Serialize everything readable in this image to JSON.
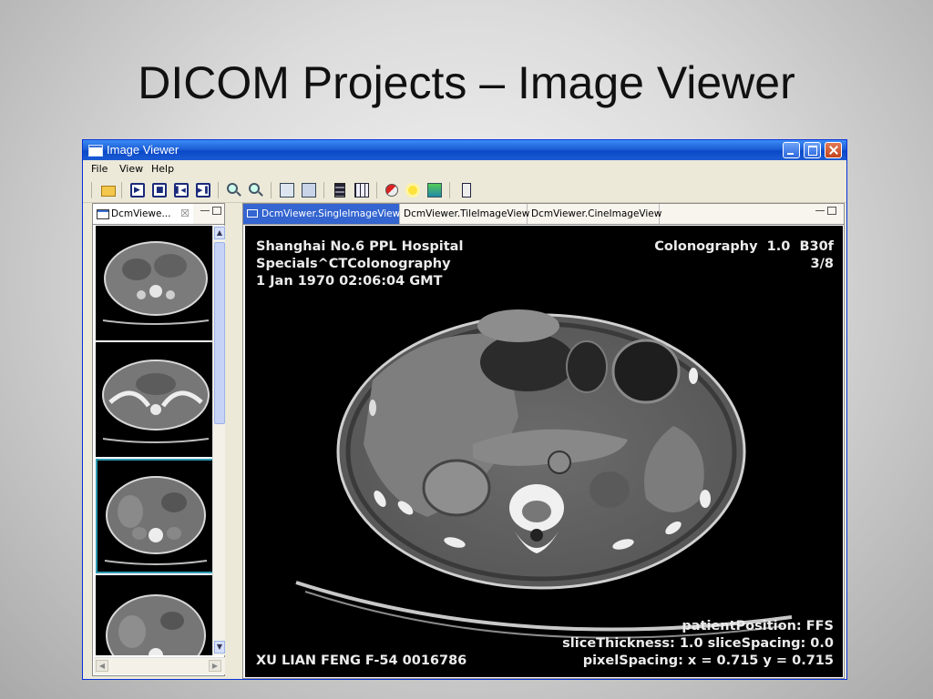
{
  "slide": {
    "title": "DICOM Projects – Image Viewer"
  },
  "window": {
    "title": "Image Viewer",
    "controls": [
      "minimize",
      "maximize",
      "close"
    ]
  },
  "menu": {
    "items": [
      "File",
      "View",
      "Help"
    ]
  },
  "toolbar": {
    "icons": [
      "open-folder-icon",
      "play-icon",
      "stop-icon",
      "first-frame-icon",
      "last-frame-icon",
      "zoom-in-icon",
      "zoom-out-icon",
      "image-info-icon",
      "film-icon",
      "film-strip-icon",
      "grid-icon",
      "invert-icon",
      "brightness-icon",
      "window-level-icon",
      "exit-icon"
    ]
  },
  "left_panel": {
    "tab_label": "DcmViewe...",
    "close_glyph": "☒",
    "thumbnails": [
      {
        "state": "normal"
      },
      {
        "state": "normal"
      },
      {
        "state": "selected"
      },
      {
        "state": "normal"
      }
    ],
    "accent_color": "#2e9bb3"
  },
  "right_panel": {
    "tabs": [
      {
        "label": "DcmViewer.SingleImageView",
        "active": true
      },
      {
        "label": "DcmViewer.TileImageView",
        "active": false
      },
      {
        "label": "DcmViewer.CineImageView",
        "active": false
      }
    ],
    "active_tab_color": "#3465d0"
  },
  "overlay": {
    "top_left": [
      "Shanghai No.6 PPL Hospital",
      "Specials^CTColonography",
      "1 Jan 1970 02:06:04 GMT"
    ],
    "top_right": [
      "Colonography  1.0  B30f",
      "3/8"
    ],
    "bottom_right": [
      "patientPosition: FFS",
      "sliceThickness: 1.0 sliceSpacing: 0.0",
      "pixelSpacing: x = 0.715 y = 0.715"
    ],
    "bottom_left": "XU LIAN FENG F-54 0016786"
  }
}
